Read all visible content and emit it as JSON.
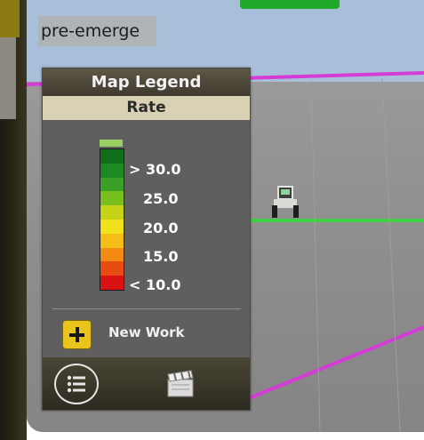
{
  "work_label": "pre-emerge",
  "legend": {
    "title": "Map Legend",
    "subtitle": "Rate",
    "scale_labels": [
      "> 30.0",
      "25.0",
      "20.0",
      "15.0",
      "< 10.0"
    ],
    "scale_colors": [
      "#0f6e1a",
      "#1b8a22",
      "#3aa126",
      "#79bf1e",
      "#c6d317",
      "#f0e21a",
      "#f5bd17",
      "#f28a14",
      "#e84c12",
      "#d91313"
    ],
    "new_work_label": "New Work"
  },
  "icons": {
    "add": "plus-icon",
    "legend_toggle": "list-icon",
    "media": "clapperboard-icon",
    "vehicle": "tractor-icon"
  }
}
